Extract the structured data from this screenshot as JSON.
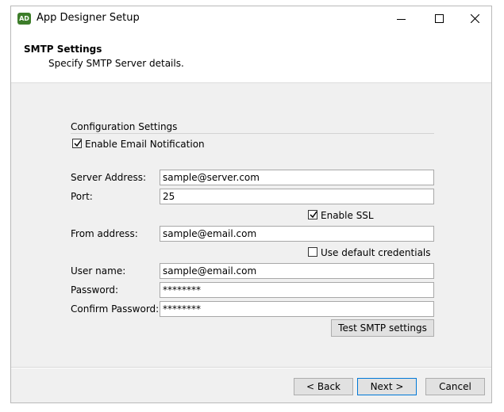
{
  "window": {
    "title": "App Designer Setup",
    "icon_text": "AD"
  },
  "header": {
    "title": "SMTP Settings",
    "subtitle": "Specify SMTP Server details."
  },
  "config": {
    "group_label": "Configuration Settings",
    "enable_email_label": "Enable Email Notification",
    "enable_email_checked": true
  },
  "fields": {
    "server_address": {
      "label": "Server Address:",
      "value": "sample@server.com"
    },
    "port": {
      "label": "Port:",
      "value": "25"
    },
    "enable_ssl": {
      "label": "Enable SSL",
      "checked": true
    },
    "from_address": {
      "label": "From address:",
      "value": "sample@email.com"
    },
    "use_default_credentials": {
      "label": "Use default credentials",
      "checked": false
    },
    "user_name": {
      "label": "User name:",
      "value": "sample@email.com"
    },
    "password": {
      "label": "Password:",
      "value": "********"
    },
    "confirm_password": {
      "label": "Confirm Password:",
      "value": "********"
    }
  },
  "buttons": {
    "test_smtp": "Test SMTP settings",
    "back": "< Back",
    "next": "Next >",
    "cancel": "Cancel"
  },
  "colors": {
    "icon_bg": "#3d7d2a",
    "default_button_border": "#0078d7"
  }
}
